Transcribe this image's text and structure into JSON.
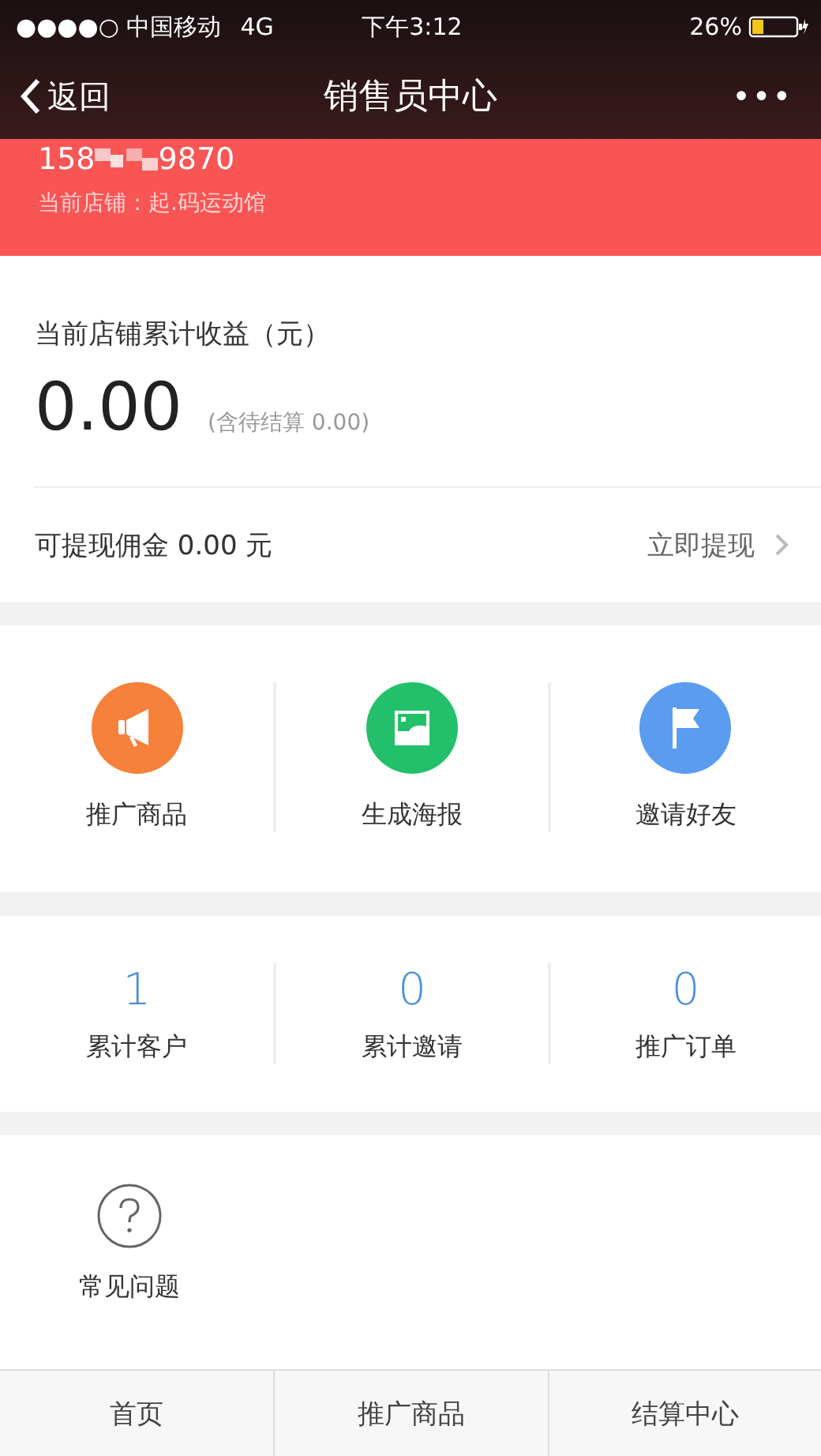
{
  "status_bar": {
    "carrier": "●●●●○ 中国移动",
    "network": "4G",
    "time": "下午3:12",
    "battery": "26%"
  },
  "nav": {
    "back": "返回",
    "title": "销售员中心",
    "more": "•••"
  },
  "account": {
    "phone_start": "158",
    "phone_end": "9870",
    "store": "当前店铺：起.码运动馆"
  },
  "earnings": {
    "label": "当前店铺累计收益（元）",
    "amount": "0.00",
    "pending": "(含待结算 0.00)",
    "withdrawable": "可提现佣金 0.00 元",
    "withdraw_link": "立即提现"
  },
  "actions": [
    {
      "label": "推广商品",
      "kind": "megaphone",
      "color": "#f5813a"
    },
    {
      "label": "生成海报",
      "kind": "image",
      "color": "#22c06a"
    },
    {
      "label": "邀请好友",
      "kind": "flag",
      "color": "#5b9cf0"
    }
  ],
  "stats": [
    {
      "value": "1",
      "label": "累计客户"
    },
    {
      "value": "0",
      "label": "累计邀请"
    },
    {
      "value": "0",
      "label": "推广订单"
    }
  ],
  "help": {
    "label": "常见问题"
  },
  "tab_bar": [
    "首页",
    "推广商品",
    "结算中心"
  ]
}
